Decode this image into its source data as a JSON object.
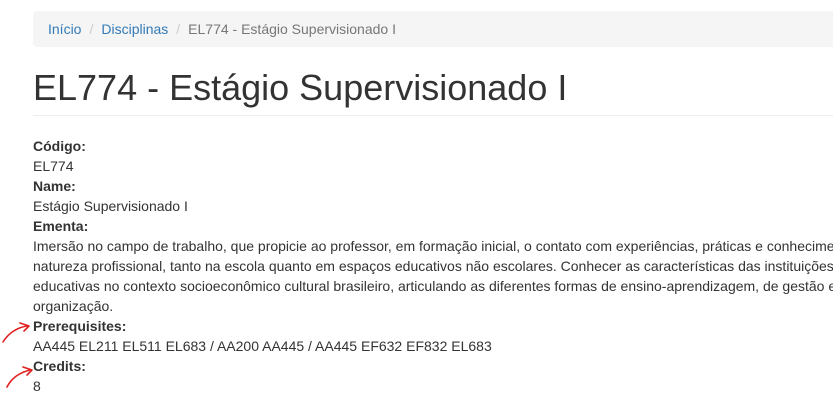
{
  "breadcrumb": {
    "items": [
      "Início",
      "Disciplinas"
    ],
    "separator": "/",
    "current": "EL774 - Estágio Supervisionado I"
  },
  "page": {
    "title": "EL774 - Estágio Supervisionado I"
  },
  "details": {
    "code_label": "Código:",
    "code_value": "EL774",
    "name_label": "Name:",
    "name_value": "Estágio Supervisionado I",
    "ementa_label": "Ementa:",
    "ementa_lines": [
      "Imersão no campo de trabalho, que propicie ao professor, em formação inicial, o contato com experiências, práticas e conhecimentos de",
      "natureza profissional, tanto na escola quanto em espaços educativos não escolares. Conhecer as características das instituições",
      "educativas no contexto socioeconômico cultural brasileiro, articulando as diferentes formas de ensino-aprendizagem, de gestão e",
      "organização."
    ],
    "prereq_label": "Prerequisites:",
    "prereq_value": "AA445 EL211 EL511 EL683 / AA200 AA445 / AA445 EF632 EF832 EL683",
    "credits_label": "Credits:",
    "credits_value": "8"
  },
  "colors": {
    "link": "#337ab7",
    "breadcrumb_bg": "#f5f5f5",
    "annotation": "#e02020"
  }
}
